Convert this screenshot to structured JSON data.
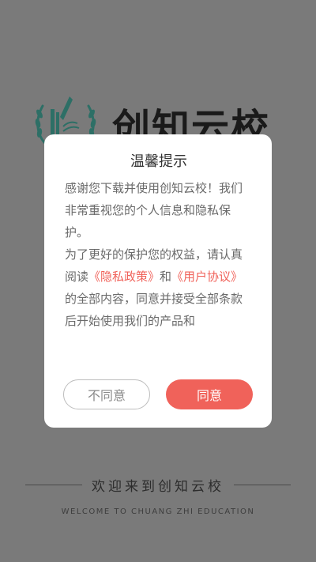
{
  "splash": {
    "app_name": "创知云校",
    "welcome_text": "欢迎来到创知云校",
    "welcome_en": "WELCOME TO CHUANG ZHI EDUCATION"
  },
  "dialog": {
    "title": "温馨提示",
    "para1": "感谢您下载并使用创知云校！我们非常重视您的个人信息和隐私保护。",
    "para2_start": "为了更好的保护您的权益，请认真阅读",
    "privacy_link": "《隐私政策》",
    "and": "和",
    "user_link": "《用户协议》",
    "para2_end": "的全部内容，同意并接受全部条款后开始使用我们的产品和",
    "disagree_label": "不同意",
    "agree_label": "同意"
  },
  "colors": {
    "accent": "#f0625a",
    "overlay": "#7a7a7a",
    "emblem": "#2d6f66"
  },
  "icons": {
    "logo": "book-laurel-emblem-icon"
  }
}
